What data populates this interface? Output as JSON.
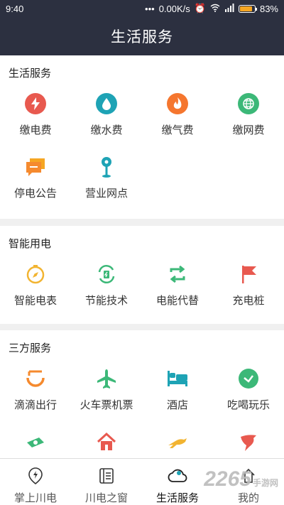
{
  "status_bar": {
    "time": "9:40",
    "network_speed": "0.00K/s",
    "battery": "83%",
    "battery_level": 0.83
  },
  "header": {
    "title": "生活服务"
  },
  "sections": [
    {
      "title": "生活服务",
      "items": [
        {
          "label": "缴电费",
          "icon": "lightning-icon",
          "color": "#e8594f"
        },
        {
          "label": "缴水费",
          "icon": "water-drop-icon",
          "color": "#1ea3b5"
        },
        {
          "label": "缴气费",
          "icon": "flame-icon",
          "color": "#f5762e"
        },
        {
          "label": "缴网费",
          "icon": "globe-icon",
          "color": "#3cb878"
        },
        {
          "label": "停电公告",
          "icon": "chat-icon",
          "color": "#f58a2e"
        },
        {
          "label": "营业网点",
          "icon": "location-pin-icon",
          "color": "#1ea3b5"
        }
      ]
    },
    {
      "title": "智能用电",
      "items": [
        {
          "label": "智能电表",
          "icon": "compass-icon",
          "color": "#f2b431"
        },
        {
          "label": "节能技术",
          "icon": "battery-recycle-icon",
          "color": "#3cb878"
        },
        {
          "label": "电能代替",
          "icon": "swap-arrows-icon",
          "color": "#3cb878"
        },
        {
          "label": "充电桩",
          "icon": "flag-icon",
          "color": "#e8594f"
        }
      ]
    },
    {
      "title": "三方服务",
      "items": [
        {
          "label": "滴滴出行",
          "icon": "didi-icon",
          "color": "#f58a2e"
        },
        {
          "label": "火车票机票",
          "icon": "airplane-icon",
          "color": "#3cb878"
        },
        {
          "label": "酒店",
          "icon": "bed-icon",
          "color": "#1ea3b5"
        },
        {
          "label": "吃喝玩乐",
          "icon": "clock-check-icon",
          "color": "#3cb878"
        },
        {
          "label": "",
          "icon": "money-icon",
          "color": "#3cb878"
        },
        {
          "label": "",
          "icon": "house-icon",
          "color": "#e8594f"
        },
        {
          "label": "",
          "icon": "kangaroo-icon",
          "color": "#f2b431"
        },
        {
          "label": "",
          "icon": "bird-icon",
          "color": "#e8594f"
        }
      ]
    }
  ],
  "tabbar": [
    {
      "label": "掌上川电",
      "icon": "location-bolt-icon"
    },
    {
      "label": "川电之窗",
      "icon": "document-icon"
    },
    {
      "label": "生活服务",
      "icon": "cloud-icon",
      "active": true
    },
    {
      "label": "我的",
      "icon": "person-icon"
    }
  ],
  "watermark": {
    "text": "2265",
    "sub": "手游网"
  }
}
